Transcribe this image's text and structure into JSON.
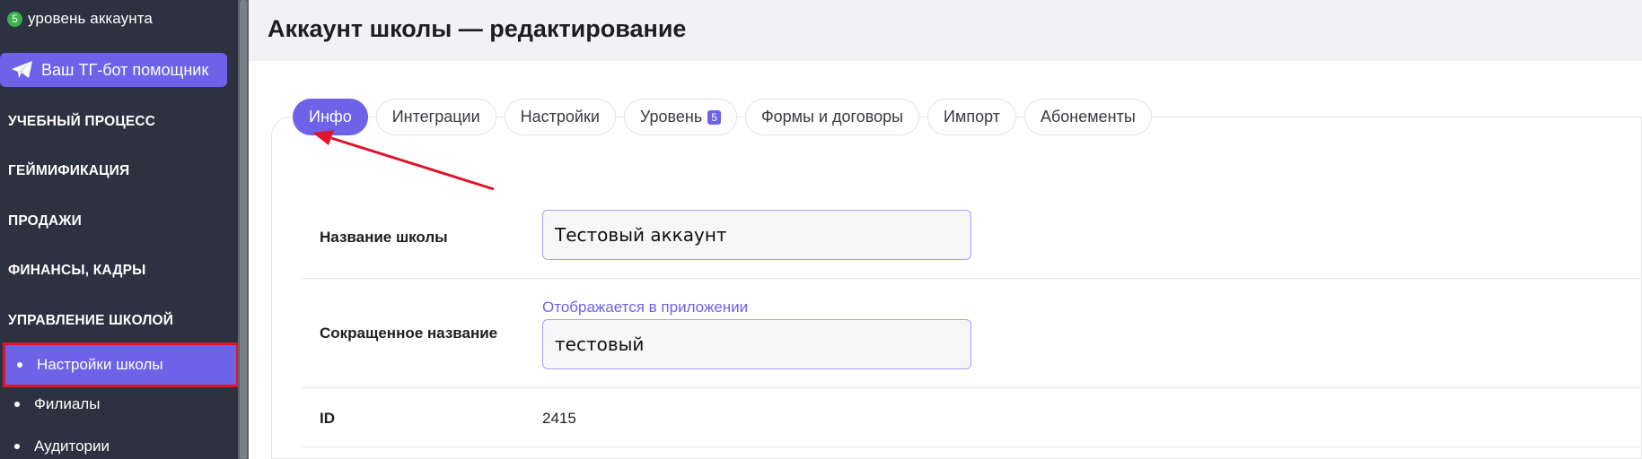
{
  "sidebar": {
    "level_badge": "5",
    "level_text": "уровень аккаунта",
    "tg_bot_label": "Ваш ТГ-бот помощник",
    "sections": [
      "УЧЕБНЫЙ ПРОЦЕСС",
      "ГЕЙМИФИКАЦИЯ",
      "ПРОДАЖИ",
      "ФИНАНСЫ, КАДРЫ",
      "УПРАВЛЕНИЕ ШКОЛОЙ"
    ],
    "sub_items": [
      "Настройки школы",
      "Филиалы",
      "Аудитории"
    ],
    "active_sub_item": "Настройки школы"
  },
  "header": {
    "title": "Аккаунт школы — редактирование"
  },
  "tabs": [
    {
      "label": "Инфо",
      "active": true
    },
    {
      "label": "Интеграции"
    },
    {
      "label": "Настройки"
    },
    {
      "label": "Уровень",
      "count": "5"
    },
    {
      "label": "Формы и договоры"
    },
    {
      "label": "Импорт"
    },
    {
      "label": "Абонементы"
    }
  ],
  "form": {
    "school_name_label": "Название школы",
    "school_name_value": "Тестовый аккаунт",
    "short_name_label": "Сокращенное название",
    "short_name_hint": "Отображается в приложении",
    "short_name_value": "тестовый",
    "id_label": "ID",
    "id_value": "2415"
  },
  "colors": {
    "sidebar_bg": "#2d3241",
    "accent": "#6c63e8",
    "highlight_outline": "#e0142c",
    "level_badge": "#37b34a",
    "annotation_arrow": "#e0142c"
  },
  "icons": {
    "tg_button": "telegram-plane-icon",
    "annotation": "red-arrow-icon"
  }
}
